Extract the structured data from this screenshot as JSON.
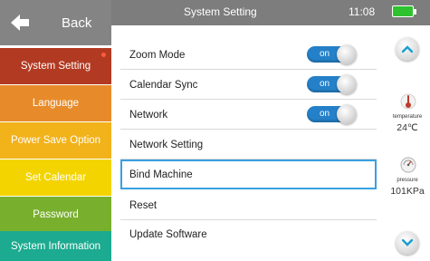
{
  "back": {
    "label": "Back"
  },
  "menu": [
    {
      "label": "System Setting"
    },
    {
      "label": "Language"
    },
    {
      "label": "Power Save Option"
    },
    {
      "label": "Set Calendar"
    },
    {
      "label": "Password"
    },
    {
      "label": "System Information"
    }
  ],
  "header": {
    "title": "System Setting",
    "time": "11:08",
    "battery": 1.0
  },
  "settings": [
    {
      "label": "Zoom Mode",
      "toggle": "on"
    },
    {
      "label": "Calendar Sync",
      "toggle": "on"
    },
    {
      "label": "Network",
      "toggle": "on"
    },
    {
      "label": "Network Setting"
    },
    {
      "label": "Bind Machine",
      "selected": true
    },
    {
      "label": "Reset"
    },
    {
      "label": "Update Software"
    }
  ],
  "sensors": {
    "temperature": {
      "label": "temperature",
      "value": "24℃"
    },
    "pressure": {
      "label": "pressure",
      "value": "101KPa"
    }
  },
  "colors": {
    "menu": [
      "#b23a22",
      "#e78b2a",
      "#f2b21a",
      "#f3d400",
      "#78b02d",
      "#1cab90"
    ],
    "toggle_on": "#2480c8",
    "selection": "#3aa0e0",
    "header": "#7d7d7d"
  }
}
